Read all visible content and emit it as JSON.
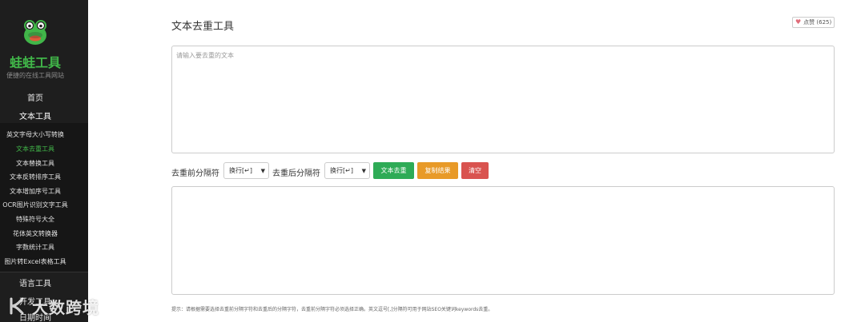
{
  "brand": {
    "name": "蛙蛙工具",
    "tagline": "便捷的在线工具网站",
    "logo_icon": "frog-logo-icon",
    "accent_color": "#41b649"
  },
  "sidebar": {
    "home": "首页",
    "category_text": "文本工具",
    "items": [
      {
        "label": "英文字母大小写转换"
      },
      {
        "label": "文本去重工具"
      },
      {
        "label": "文本替换工具"
      },
      {
        "label": "文本反转排序工具"
      },
      {
        "label": "文本增加序号工具"
      },
      {
        "label": "OCR图片识别文字工具"
      },
      {
        "label": "特殊符号大全"
      },
      {
        "label": "花体英文转换器"
      },
      {
        "label": "字数统计工具"
      },
      {
        "label": "图片转Excel表格工具"
      }
    ],
    "category_lang": "语言工具",
    "category_dev": "开发工具",
    "category_date": "日期时间"
  },
  "main": {
    "title": "文本去重工具",
    "like_label": "点赞 (625)",
    "input_placeholder": "请输入要去重的文本",
    "input_value": "",
    "output_value": "",
    "before_sep_label": "去重前分隔符",
    "before_sep_value": "换行[↵]",
    "after_sep_label": "去重后分隔符",
    "after_sep_value": "换行[↵]",
    "dedupe_button": "文本去重",
    "copy_button": "复制结果",
    "clear_button": "清空",
    "hint": "提示：请根据需要选择去重前分隔字符和去重后的分隔字符，去重前分隔字符必须选择正确。英文逗号[,]分隔符可用于网站SEO关键词keywords去重。"
  },
  "watermark": {
    "text": "大数跨境"
  },
  "colors": {
    "green": "#2eab56",
    "orange": "#e89a28",
    "red": "#d9534f",
    "sidebar_bg": "#1e1e1e"
  }
}
